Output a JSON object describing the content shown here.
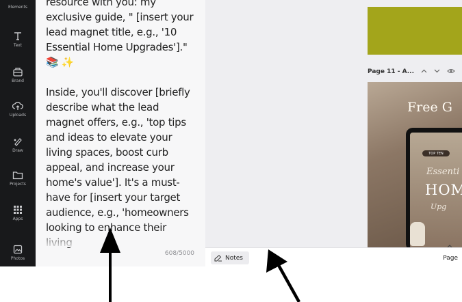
{
  "sidebar": {
    "items": [
      {
        "label": "Elements",
        "icon": "elements-icon"
      },
      {
        "label": "Text",
        "icon": "text-icon"
      },
      {
        "label": "Brand",
        "icon": "brand-icon"
      },
      {
        "label": "Uploads",
        "icon": "uploads-icon"
      },
      {
        "label": "Draw",
        "icon": "draw-icon"
      },
      {
        "label": "Projects",
        "icon": "folder-icon"
      },
      {
        "label": "Apps",
        "icon": "apps-icon"
      },
      {
        "label": "Photos",
        "icon": "photos-icon"
      }
    ]
  },
  "notes": {
    "paragraph1": "resource with you: my exclusive guide, \" [insert your lead magnet title, e.g., '10 Essential Home Upgrades'].\" 📚 ✨",
    "paragraph2": "Inside, you'll discover [briefly describe what the lead magnet offers, e.g., 'top tips and ideas to elevate your living spaces, boost curb appeal, and increase your home's value']. It's a must-have for [insert your target audience, e.g., 'homeowners looking to enhance their living",
    "char_count": "608/5000"
  },
  "canvas": {
    "page_label": "Page 11 - A...",
    "thumb_title": "Free G",
    "thumb_tag": "TOP TEN",
    "thumb_script": "Essenti",
    "thumb_home": "HOM",
    "thumb_up": "Upg"
  },
  "bottom_bar": {
    "notes_label": "Notes",
    "page_label": "Page"
  },
  "colors": {
    "sidebar": "#18191b",
    "olive_block": "#a3a51b",
    "notes_bg": "#f7f7f8",
    "canvas_bg": "#eeeef1"
  }
}
